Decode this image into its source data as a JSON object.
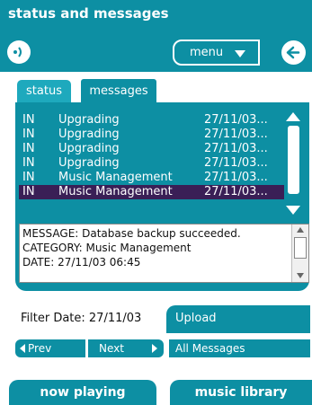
{
  "window": {
    "title": "status and messages"
  },
  "toolbar": {
    "menu_label": "menu",
    "speaker_icon": "speaker-icon",
    "back_icon": "back-arrow-icon"
  },
  "tabs": [
    {
      "label": "status",
      "active": false
    },
    {
      "label": "messages",
      "active": true
    }
  ],
  "messages": {
    "rows": [
      {
        "type": "IN",
        "subject": "Upgrading",
        "date": "27/11/03..."
      },
      {
        "type": "IN",
        "subject": "Upgrading",
        "date": "27/11/03..."
      },
      {
        "type": "IN",
        "subject": "Upgrading",
        "date": "27/11/03..."
      },
      {
        "type": "IN",
        "subject": "Upgrading",
        "date": "27/11/03..."
      },
      {
        "type": "IN",
        "subject": "Music Management",
        "date": "27/11/03..."
      },
      {
        "type": "IN",
        "subject": "Music Management",
        "date": "27/11/03...",
        "selected": true
      }
    ],
    "selected_index": 5
  },
  "detail": {
    "message": "MESSAGE: Database backup succeeded.",
    "category": "CATEGORY: Music Management",
    "date": "DATE: 27/11/03 06:45"
  },
  "filter": {
    "label": "Filter Date: 27/11/03",
    "upload_label": "Upload",
    "prev_label": "Prev",
    "next_label": "Next",
    "all_messages_label": "All Messages"
  },
  "bottom_nav": {
    "now_playing": "now playing",
    "music_library": "music library"
  },
  "colors": {
    "accent": "#0d8fa3",
    "tab_inactive": "#1ea9bd",
    "selection": "#3a1f56"
  }
}
